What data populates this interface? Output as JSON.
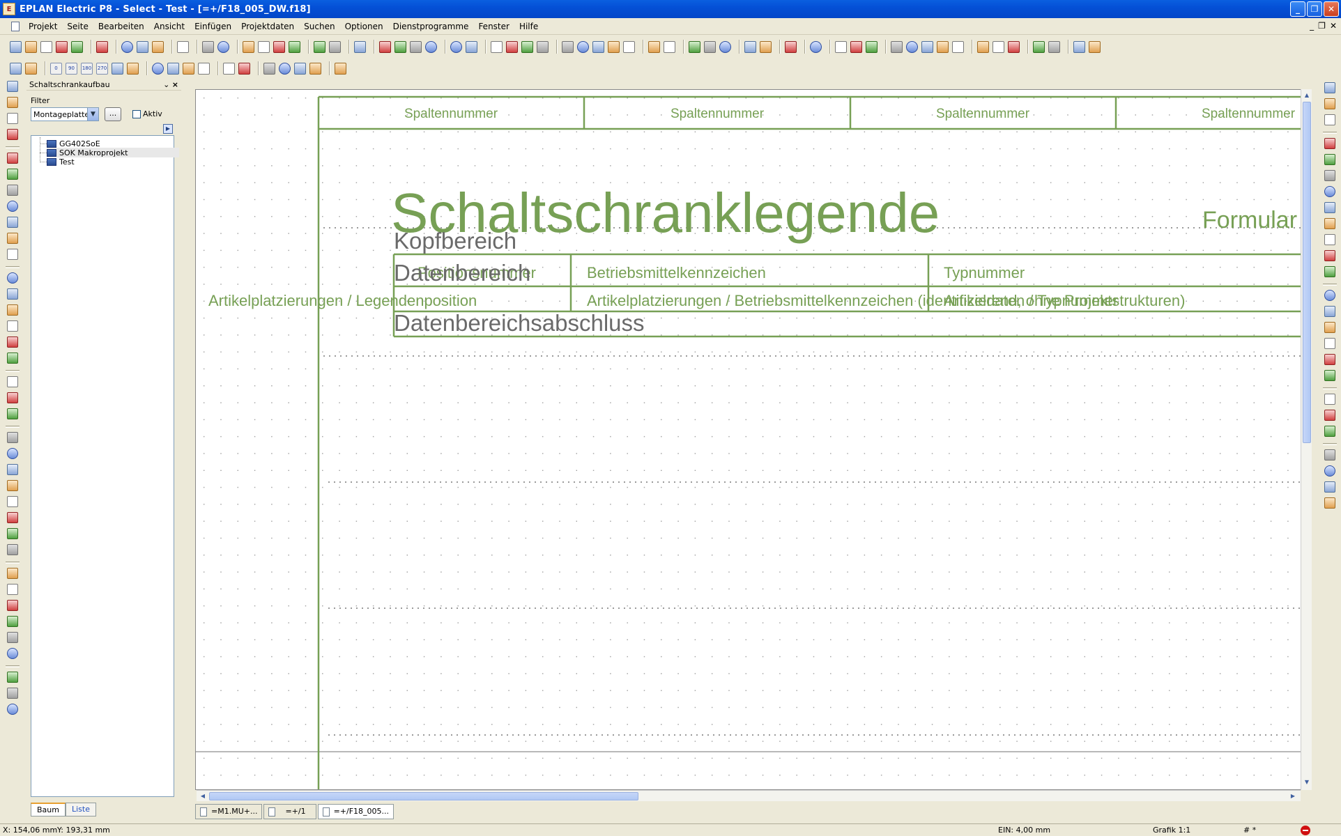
{
  "window": {
    "title": "EPLAN Electric P8 - Select - Test - [=+/F18_005_DW.f18]"
  },
  "menu": [
    "Projekt",
    "Seite",
    "Bearbeiten",
    "Ansicht",
    "Einfügen",
    "Projektdaten",
    "Suchen",
    "Optionen",
    "Dienstprogramme",
    "Fenster",
    "Hilfe"
  ],
  "toolbar2_labels": [
    "0",
    "90",
    "180",
    "270"
  ],
  "panel": {
    "title": "Schaltschrankaufbau",
    "close": "×",
    "filter_label": "Filter",
    "filter_value": "Montageplatte l",
    "dots_label": "...",
    "aktiv_label": "Aktiv",
    "tree_items": [
      "GG402SoE",
      "SOK Makroprojekt",
      "Test"
    ],
    "tabs": [
      "Baum",
      "Liste"
    ]
  },
  "drawing": {
    "column_headers": [
      "Spaltennummer",
      "Spaltennummer",
      "Spaltennummer",
      "Spaltennummer"
    ],
    "main_title": "Schaltschranklegende",
    "formular": "Formular",
    "kopfbereich": "Kopfbereich",
    "datenbereich": "Datenbereich",
    "row1": [
      "Positionsnummer",
      "Betriebsmittelkennzeichen",
      "Typnummer"
    ],
    "row2": [
      "Artikelplatzierungen / Legendenposition",
      "Artikelplatzierungen / Betriebsmittelkennzeichen (identifizierend, ohne Projektstrukturen)",
      "Artikeldaten / Typnummer"
    ],
    "abschluss": "Datenbereichsabschluss"
  },
  "page_tabs": [
    "=M1.MU+...",
    "=+/1",
    "=+/F18_005..."
  ],
  "status": {
    "x": "X: 154,06 mm",
    "y": "Y: 193,31 mm",
    "ein": "EIN: 4,00 mm",
    "grafik": "Grafik 1:1",
    "hash": "# *"
  },
  "colors": {
    "drawing_green": "#77a055",
    "gray_text": "#6a6a6a",
    "title_blue": "#0450d6"
  }
}
